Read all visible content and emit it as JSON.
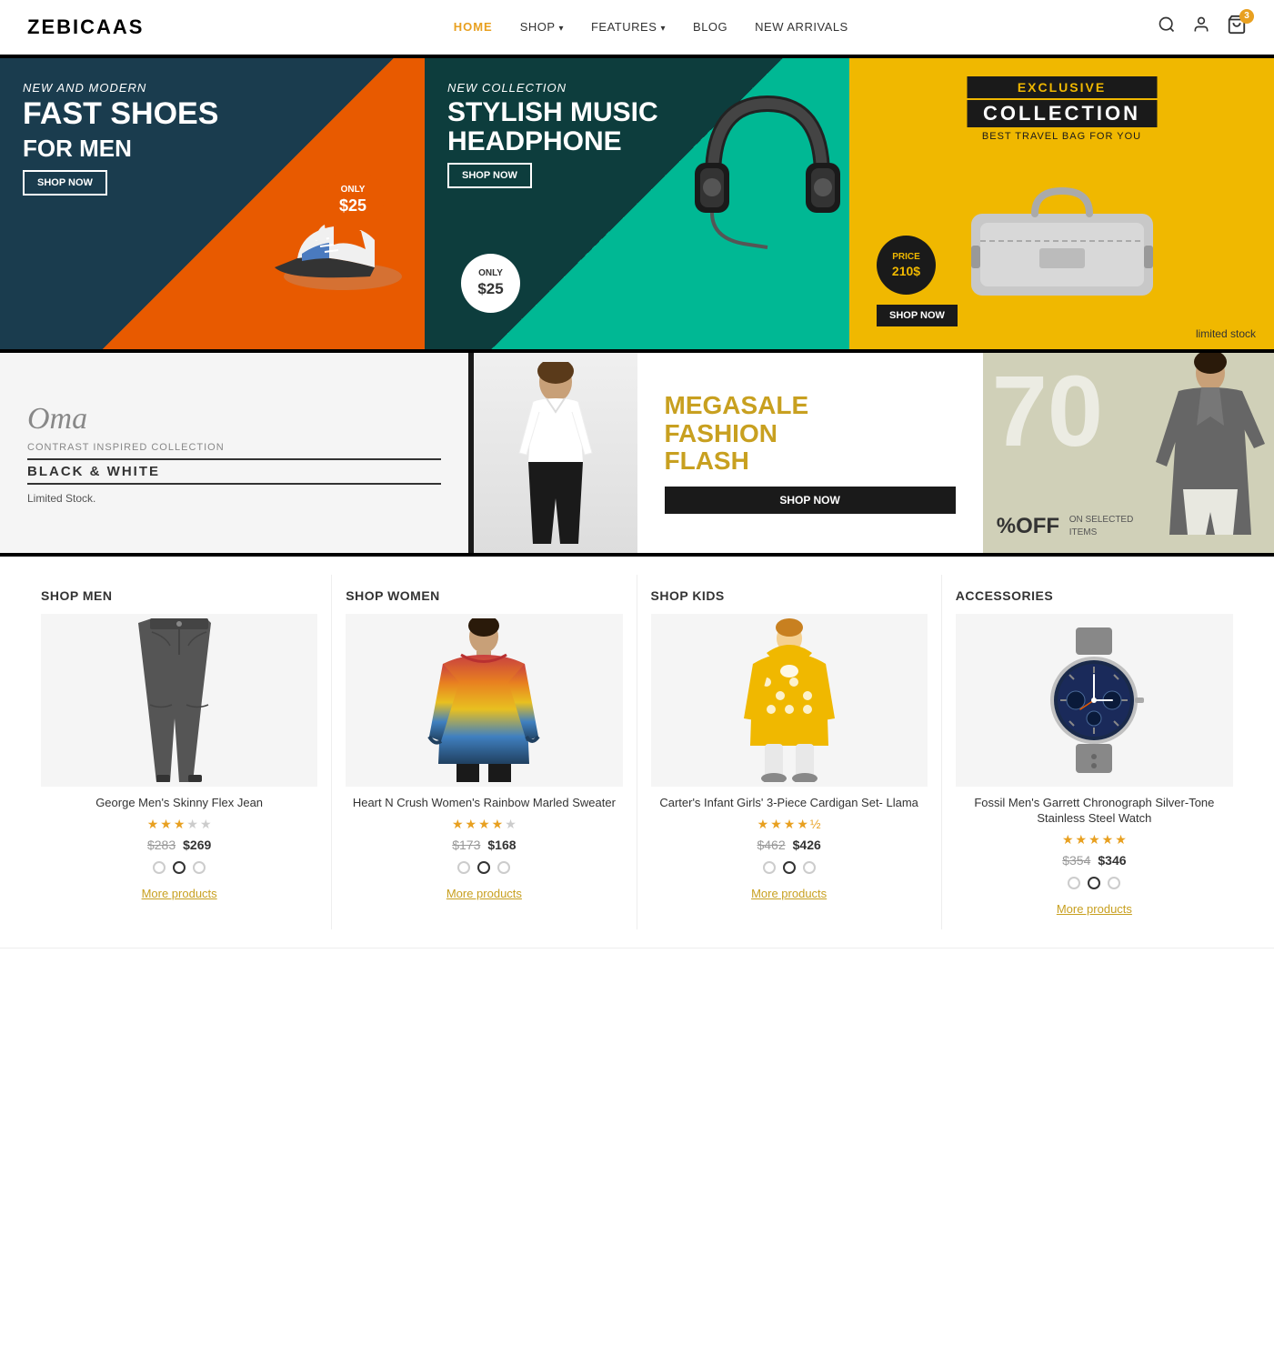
{
  "header": {
    "logo": "ZEBICAAS",
    "nav": [
      {
        "label": "HOME",
        "active": true,
        "hasArrow": false
      },
      {
        "label": "SHOP",
        "active": false,
        "hasArrow": true
      },
      {
        "label": "FEATURES",
        "active": false,
        "hasArrow": true
      },
      {
        "label": "BLOG",
        "active": false,
        "hasArrow": false
      },
      {
        "label": "NEW ARRIVALS",
        "active": false,
        "hasArrow": false
      }
    ],
    "cart_count": "3"
  },
  "banners_top": [
    {
      "id": "banner-shoes",
      "subtitle": "New and Modern",
      "title": "FAST SHOES\nFOR MEN",
      "price": "ONLY\n$25",
      "btn": "SHOP NOW"
    },
    {
      "id": "banner-headphone",
      "subtitle": "New Collection",
      "title": "STYLISH MUSIC\nHEADPHONE",
      "price": "ONLY\n$25",
      "btn": "SHOP NOW"
    },
    {
      "id": "banner-bag",
      "top_label": "EXCLUSIVE",
      "title": "COLLECTION",
      "subtitle": "BEST TRAVEL BAG FOR YOU",
      "price": "PRICE\n210$",
      "btn": "SHOP NOW",
      "limited": "limited stock"
    }
  ],
  "banners_mid": [
    {
      "id": "banner-bw",
      "cursive": "Oma",
      "tagline": "Contrast inspired collection",
      "title": "BLACK & WHITE",
      "limited": "Limited Stock."
    },
    {
      "id": "banner-megasale",
      "title": "MEGASALE\nFASHION\nFLASH",
      "btn": "SHOP NOW",
      "discount": "70",
      "off": "%OFF",
      "selected": "ON SELECTED\nITEMS"
    }
  ],
  "shop_sections": [
    {
      "id": "men",
      "title": "SHOP MEN",
      "product": {
        "name": "George Men's Skinny Flex Jean",
        "stars": [
          1,
          1,
          1,
          0,
          0
        ],
        "price_old": "$283",
        "price_new": "$269",
        "colors": [
          "#fff",
          "#555",
          "#fff"
        ],
        "color_active": 1
      },
      "more": "More products"
    },
    {
      "id": "women",
      "title": "SHOP WOMEN",
      "product": {
        "name": "Heart N Crush Women's Rainbow Marled Sweater",
        "stars": [
          1,
          1,
          1,
          1,
          0
        ],
        "price_old": "$173",
        "price_new": "$168",
        "colors": [
          "#fff",
          "#555",
          "#fff"
        ],
        "color_active": 1
      },
      "more": "More products"
    },
    {
      "id": "kids",
      "title": "SHOP KIDS",
      "product": {
        "name": "Carter's Infant Girls' 3-Piece Cardigan Set- Llama",
        "stars": [
          1,
          1,
          1,
          1,
          0.5
        ],
        "price_old": "$462",
        "price_new": "$426",
        "colors": [
          "#fff",
          "#555",
          "#fff"
        ],
        "color_active": 1
      },
      "more": "More products"
    },
    {
      "id": "accessories",
      "title": "ACCESSORIES",
      "product": {
        "name": "Fossil Men's Garrett Chronograph Silver-Tone Stainless Steel Watch",
        "stars": [
          1,
          1,
          1,
          1,
          1
        ],
        "price_old": "$354",
        "price_new": "$346",
        "colors": [
          "#fff",
          "#555",
          "#fff"
        ],
        "color_active": 1
      },
      "more": "More products"
    }
  ]
}
